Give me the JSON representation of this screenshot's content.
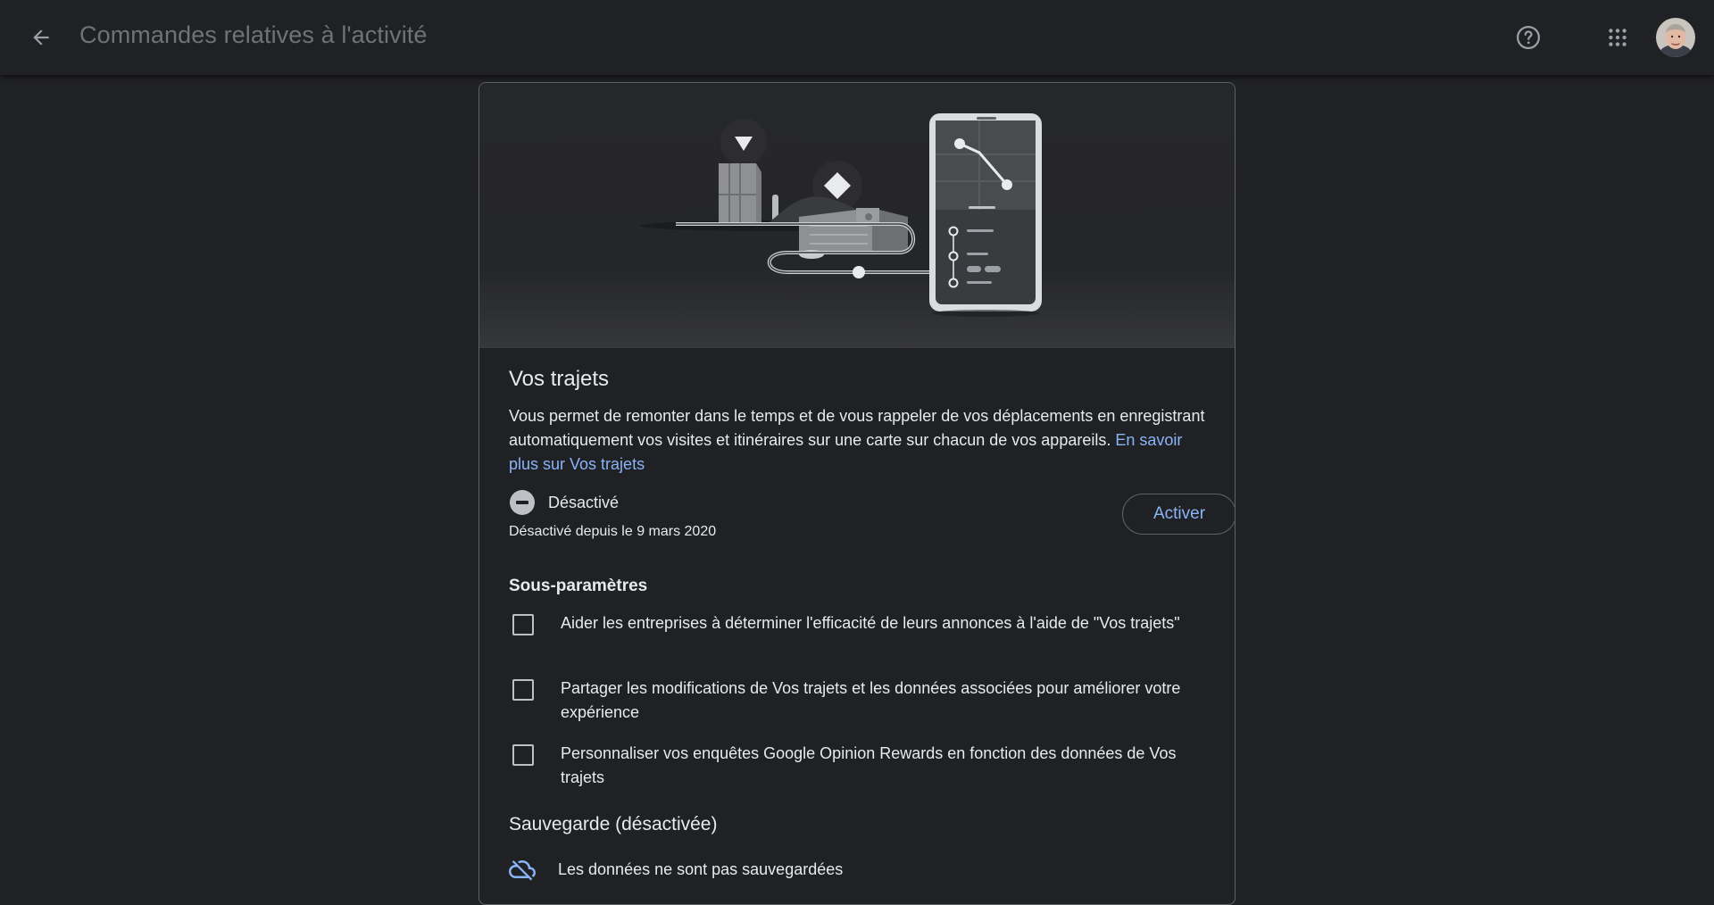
{
  "header": {
    "back_icon": "arrow-back-icon",
    "title": "Commandes relatives à l'activité",
    "help_icon": "help-circle-icon",
    "apps_icon": "apps-grid-icon",
    "avatar_icon": "account-avatar"
  },
  "card": {
    "illustration": "location-history-illustration",
    "title": "Vos trajets",
    "description": "Vous permet de remonter dans le temps et de vous rappeler de vos déplacements en enregistrant automatiquement vos visites et itinéraires sur une carte sur chacun de vos appareils. ",
    "learn_more": "En savoir plus sur Vos trajets",
    "status": {
      "icon": "minus-circle-icon",
      "label": "Désactivé",
      "since": "Désactivé depuis le 9 mars 2020"
    },
    "activate_label": "Activer",
    "subsettings_title": "Sous-paramètres",
    "subsettings": [
      {
        "label": "Aider les entreprises à déterminer l'efficacité de leurs annonces à l'aide de \"Vos trajets\"",
        "checked": false
      },
      {
        "label": "Partager les modifications de Vos trajets et les données associées pour améliorer votre expérience",
        "checked": false
      },
      {
        "label": "Personnaliser vos enquêtes Google Opinion Rewards en fonction des données de Vos trajets",
        "checked": false
      }
    ],
    "backup_title": "Sauvegarde (désactivée)",
    "backup_icon": "cloud-off-icon",
    "backup_text": "Les données ne sont pas sauvegardées"
  },
  "colors": {
    "background": "#202124",
    "accent": "#8ab4f8",
    "text": "#e8eaed",
    "muted_title": "#6f7276",
    "border": "#5f6368"
  }
}
